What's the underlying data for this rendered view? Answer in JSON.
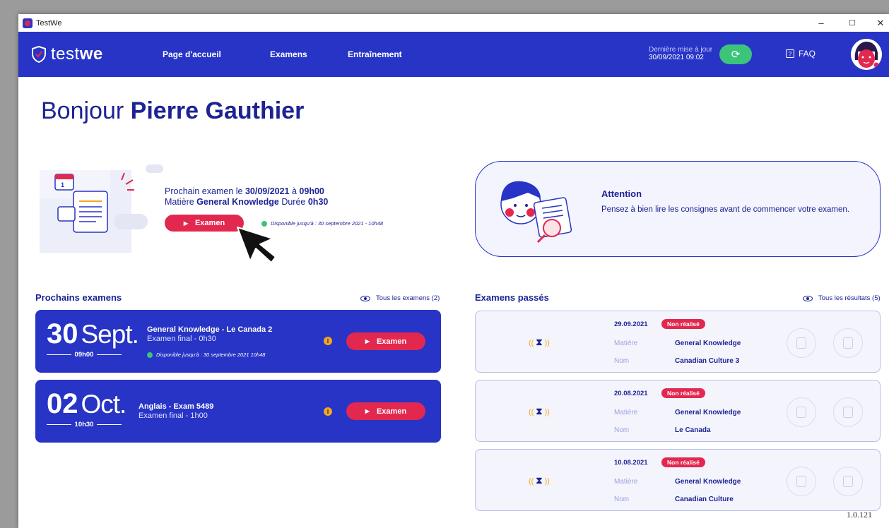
{
  "window": {
    "title": "TestWe",
    "minimize": "–",
    "maximize": "☐",
    "close": "✕"
  },
  "nav": {
    "brand_light": "test",
    "brand_bold": "we",
    "items": [
      "Page d'accueil",
      "Examens",
      "Entraînement"
    ],
    "update_label": "Dernière mise à jour",
    "update_date": "30/09/2021 09:02",
    "faq": "FAQ"
  },
  "greeting": {
    "hello": "Bonjour",
    "name": "Pierre Gauthier"
  },
  "next_exam": {
    "line1_prefix": "Prochain examen le ",
    "date": "30/09/2021",
    "at": " à ",
    "time": "09h00",
    "subject_label": "Matière ",
    "subject": "General Knowledge",
    "duration_label": " Durée ",
    "duration": "0h30",
    "button": "Examen",
    "availability": "Disponible jusqu'à : 30 septembre 2021 - 10h48"
  },
  "attention": {
    "title": "Attention",
    "text": "Pensez à bien lire les consignes avant de commencer votre examen."
  },
  "upcoming": {
    "title": "Prochains examens",
    "link": "Tous les examens (2)",
    "cards": [
      {
        "day": "30",
        "month": "Sept.",
        "time": "09h00",
        "title": "General Knowledge - Le Canada 2",
        "sub": "Examen final - 0h30",
        "availability": "Disponible jusqu'à : 30 septembre 2021 10h48",
        "button": "Examen"
      },
      {
        "day": "02",
        "month": "Oct.",
        "time": "10h30",
        "title": "Anglais - Exam 5489",
        "sub": "Examen final - 1h00",
        "button": "Examen"
      }
    ]
  },
  "past": {
    "title": "Examens passés",
    "link": "Tous les résultats (5)",
    "label_subject": "Matière",
    "label_name": "Nom",
    "cards": [
      {
        "date": "29.09.2021",
        "status": "Non réalisé",
        "subject": "General Knowledge",
        "name": "Canadian Culture 3"
      },
      {
        "date": "20.08.2021",
        "status": "Non réalisé",
        "subject": "General Knowledge",
        "name": "Le Canada"
      },
      {
        "date": "10.08.2021",
        "status": "Non réalisé",
        "subject": "General Knowledge",
        "name": "Canadian Culture"
      }
    ]
  },
  "version": "1.0.121"
}
